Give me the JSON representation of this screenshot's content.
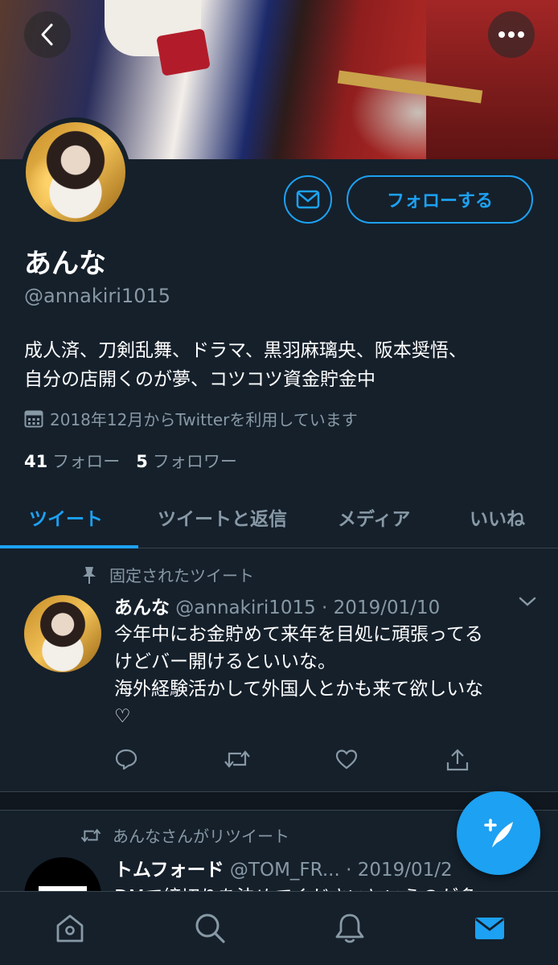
{
  "profile": {
    "name": "あんな",
    "handle": "@annakiri1015",
    "bio_line1": "成人済、刀剣乱舞、ドラマ、黒羽麻璃央、阪本奨悟、",
    "bio_line2": "自分の店開くのが夢、コツコツ資金貯金中",
    "joined": "2018年12月からTwitterを利用しています",
    "following_count": "41",
    "following_label": "フォロー",
    "followers_count": "5",
    "followers_label": "フォロワー",
    "follow_button": "フォローする"
  },
  "tabs": [
    {
      "label": "ツイート",
      "active": true
    },
    {
      "label": "ツイートと返信",
      "active": false
    },
    {
      "label": "メディア",
      "active": false
    },
    {
      "label": "いいね",
      "active": false
    }
  ],
  "pinned_tweet": {
    "label": "固定されたツイート",
    "name": "あんな",
    "handle_date": " @annakiri1015 · 2019/01/10",
    "text_line1": "今年中にお金貯めて来年を目処に頑張ってる",
    "text_line2": "けどバー開けるといいな。",
    "text_line3": "海外経験活かして外国人とかも来て欲しいな",
    "text_line4": "♡"
  },
  "retweet": {
    "label": "あんなさんがリツイート",
    "name": "トムフォード",
    "handle": " @TOM_FR...",
    "date": " · 2019/01/2",
    "text": "DMで締切りを決めてくださいというのが多"
  },
  "colors": {
    "background": "#15202b",
    "accent": "#1da1f2",
    "secondary_text": "#8899a6",
    "border": "#38444d"
  },
  "icons": {
    "back": "chevron-left-icon",
    "more": "more-dots-icon",
    "message": "envelope-icon",
    "calendar": "calendar-icon",
    "pin": "pin-icon",
    "retweet": "retweet-icon",
    "compose": "compose-tweet-icon",
    "home": "home-icon",
    "search": "search-icon",
    "notifications": "bell-icon",
    "messages": "mail-icon"
  }
}
